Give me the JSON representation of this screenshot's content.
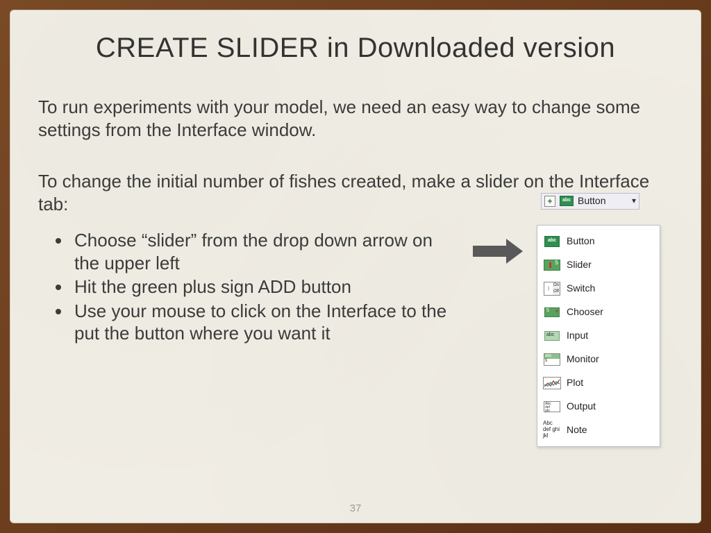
{
  "title": "CREATE SLIDER in Downloaded version",
  "para1": "To run experiments with your model, we need an easy way to change some settings from the Interface window.",
  "para2": "To change the initial number of fishes created, make a slider on the Interface tab:",
  "steps": [
    "Choose “slider” from the drop down arrow on the upper left",
    "Hit the green plus sign ADD button",
    "Use your mouse to click on the Interface to the put the button where you want it"
  ],
  "netlogo": {
    "selector_label": "Button",
    "selector_chevron": "▾",
    "items": [
      "Button",
      "Slider",
      "Switch",
      "Chooser",
      "Input",
      "Monitor",
      "Plot",
      "Output",
      "Note"
    ],
    "note_icon_text": "Abc def ghi jkl"
  },
  "page_number": "37"
}
